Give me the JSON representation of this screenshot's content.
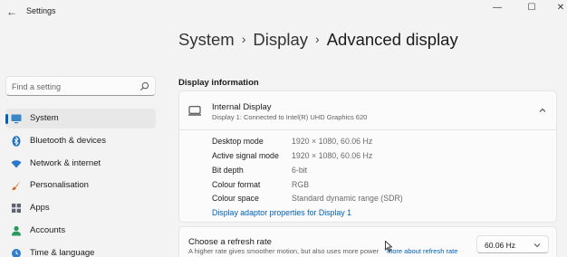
{
  "window": {
    "title": "Settings",
    "back_glyph": "←",
    "minimize_glyph": "—",
    "maximize_glyph": "☐",
    "close_glyph": "✕"
  },
  "search": {
    "placeholder": "Find a setting",
    "value": ""
  },
  "nav": {
    "items": [
      {
        "label": "System",
        "icon": "monitor-icon",
        "active": true
      },
      {
        "label": "Bluetooth & devices",
        "icon": "bluetooth-icon",
        "active": false
      },
      {
        "label": "Network & internet",
        "icon": "wifi-icon",
        "active": false
      },
      {
        "label": "Personalisation",
        "icon": "brush-icon",
        "active": false
      },
      {
        "label": "Apps",
        "icon": "apps-icon",
        "active": false
      },
      {
        "label": "Accounts",
        "icon": "person-icon",
        "active": false
      },
      {
        "label": "Time & language",
        "icon": "globe-clock-icon",
        "active": false
      }
    ]
  },
  "breadcrumb": {
    "items": [
      "System",
      "Display",
      "Advanced display"
    ],
    "separator": "›"
  },
  "display_info": {
    "section_title": "Display information",
    "display_name": "Internal Display",
    "display_subtitle": "Display 1: Connected to Intel(R) UHD Graphics 620",
    "rows": [
      {
        "key": "Desktop mode",
        "value": "1920 × 1080, 60.06 Hz"
      },
      {
        "key": "Active signal mode",
        "value": "1920 × 1080, 60.06 Hz"
      },
      {
        "key": "Bit depth",
        "value": "6-bit"
      },
      {
        "key": "Colour format",
        "value": "RGB"
      },
      {
        "key": "Colour space",
        "value": "Standard dynamic range (SDR)"
      }
    ],
    "adapter_link": "Display adaptor properties for Display 1"
  },
  "refresh_rate": {
    "title": "Choose a refresh rate",
    "description": "A higher rate gives smoother motion, but also uses more power",
    "learn_more": "More about refresh rate",
    "selected": "60.06 Hz"
  },
  "colors": {
    "accent": "#005fb8",
    "background": "#f3f3f3",
    "card": "#fbfbfb"
  }
}
